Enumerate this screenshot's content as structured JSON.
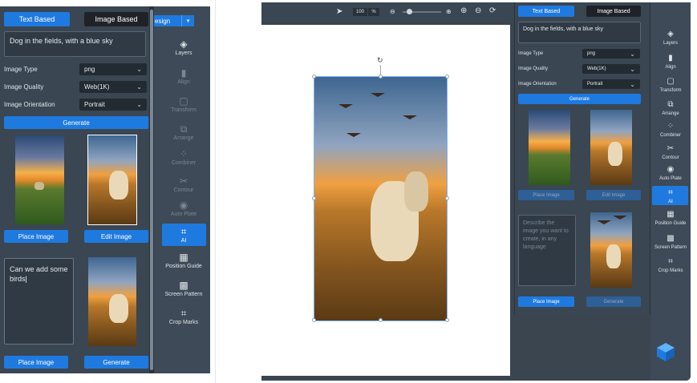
{
  "left": {
    "tabs": {
      "text_based": "Text Based",
      "image_based": "Image Based"
    },
    "design_label": "esign",
    "prompt": "Dog in the fields, with a blue sky",
    "fields": [
      {
        "label": "Image Type",
        "value": "png"
      },
      {
        "label": "Image Quality",
        "value": "Web(1K)"
      },
      {
        "label": "Image Orientation",
        "value": "Portrait"
      }
    ],
    "generate_label": "Generate",
    "place_image_label": "Place Image",
    "edit_image_label": "Edit Image",
    "edit_prompt": "Can we add some birds",
    "place_image_label_2": "Place Image",
    "generate_label_2": "Generate",
    "rail": [
      {
        "label": "Layers",
        "icon": "layers-icon"
      },
      {
        "label": "Align",
        "icon": "align-icon"
      },
      {
        "label": "Transform",
        "icon": "transform-icon"
      },
      {
        "label": "Arrange",
        "icon": "arrange-icon"
      },
      {
        "label": "Combiner",
        "icon": "combiner-icon"
      },
      {
        "label": "Contour",
        "icon": "contour-icon"
      },
      {
        "label": "Auto Plate",
        "icon": "auto-plate-icon"
      },
      {
        "label": "AI",
        "icon": "ai-chip-icon"
      },
      {
        "label": "Position Guide",
        "icon": "position-guide-icon"
      },
      {
        "label": "Screen Pattern",
        "icon": "screen-pattern-icon"
      },
      {
        "label": "Crop Marks",
        "icon": "crop-marks-icon"
      }
    ]
  },
  "right": {
    "zoom_value": "100",
    "zoom_unit": "%",
    "tabs": {
      "text_based": "Text Based",
      "image_based": "Image Based"
    },
    "design_label": "esign",
    "prompt": "Dog in the fields, with a blue sky",
    "fields": [
      {
        "label": "Image Type",
        "value": "png"
      },
      {
        "label": "Image Quality",
        "value": "Web(1K)"
      },
      {
        "label": "Image Orientation",
        "value": "Portrait"
      }
    ],
    "generate_label": "Generate",
    "place_image_label": "Place Image",
    "edit_image_label": "Edit Image",
    "describe_placeholder": "Describe the image you want to create, in any language",
    "place_image_label_2": "Place Image",
    "generate_label_2": "Generate",
    "rail": [
      {
        "label": "Layers"
      },
      {
        "label": "Align"
      },
      {
        "label": "Transform"
      },
      {
        "label": "Arrange"
      },
      {
        "label": "Combiner"
      },
      {
        "label": "Contour"
      },
      {
        "label": "Auto Plate"
      },
      {
        "label": "AI"
      },
      {
        "label": "Position Guide"
      },
      {
        "label": "Screen Pattern"
      },
      {
        "label": "Crop Marks"
      }
    ]
  },
  "colors": {
    "accent": "#1f7ae0",
    "panel": "#3a4652",
    "rail": "#3e4a57"
  }
}
